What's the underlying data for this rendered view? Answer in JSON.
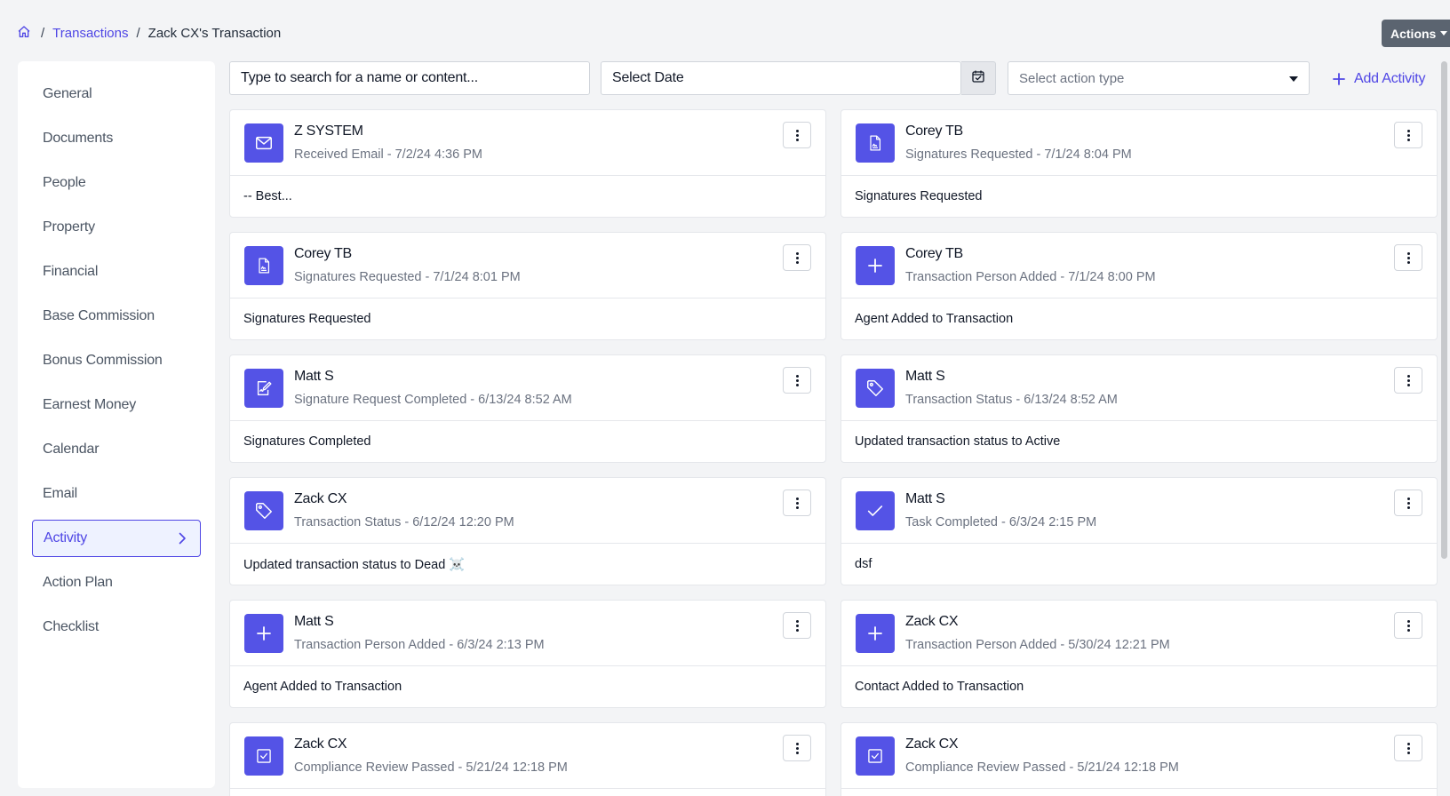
{
  "breadcrumb": {
    "home_icon": "home-icon",
    "separator": "/",
    "transactions": "Transactions",
    "current": "Zack CX's Transaction"
  },
  "actions": {
    "label": "Actions"
  },
  "sidebar": {
    "items": [
      {
        "label": "General"
      },
      {
        "label": "Documents"
      },
      {
        "label": "People"
      },
      {
        "label": "Property"
      },
      {
        "label": "Financial"
      },
      {
        "label": "Base Commission"
      },
      {
        "label": "Bonus Commission"
      },
      {
        "label": "Earnest Money"
      },
      {
        "label": "Calendar"
      },
      {
        "label": "Email"
      },
      {
        "label": "Activity",
        "active": true
      },
      {
        "label": "Action Plan"
      },
      {
        "label": "Checklist"
      }
    ]
  },
  "filters": {
    "search_placeholder": "Type to search for a name or content...",
    "date_placeholder": "Select Date",
    "action_type_placeholder": "Select action type",
    "add_activity": "Add Activity"
  },
  "colors": {
    "accent": "#4f46e5",
    "icon_bg": "#5453e6"
  },
  "activities": [
    {
      "icon": "envelope-icon",
      "name": "Z SYSTEM",
      "meta": "Received Email - 7/2/24 4:36 PM",
      "body": "-- Best..."
    },
    {
      "icon": "signature-document-icon",
      "name": "Corey TB",
      "meta": "Signatures Requested - 7/1/24 8:04 PM",
      "body": "Signatures Requested"
    },
    {
      "icon": "signature-document-icon",
      "name": "Corey TB",
      "meta": "Signatures Requested - 7/1/24 8:01 PM",
      "body": "Signatures Requested"
    },
    {
      "icon": "plus-icon",
      "name": "Corey TB",
      "meta": "Transaction Person Added - 7/1/24 8:00 PM",
      "body": "Agent Added to Transaction"
    },
    {
      "icon": "signed-document-icon",
      "name": "Matt S",
      "meta": "Signature Request Completed - 6/13/24 8:52 AM",
      "body": "Signatures Completed"
    },
    {
      "icon": "tag-icon",
      "name": "Matt S",
      "meta": "Transaction Status - 6/13/24 8:52 AM",
      "body": "Updated transaction status to Active"
    },
    {
      "icon": "tag-icon",
      "name": "Zack CX",
      "meta": "Transaction Status - 6/12/24 12:20 PM",
      "body": "Updated transaction status to Dead ☠️"
    },
    {
      "icon": "checkmark-icon",
      "name": "Matt S",
      "meta": "Task Completed - 6/3/24 2:15 PM",
      "body": "dsf"
    },
    {
      "icon": "plus-icon",
      "name": "Matt S",
      "meta": "Transaction Person Added - 6/3/24 2:13 PM",
      "body": "Agent Added to Transaction"
    },
    {
      "icon": "plus-icon",
      "name": "Zack CX",
      "meta": "Transaction Person Added - 5/30/24 12:21 PM",
      "body": "Contact Added to Transaction"
    },
    {
      "icon": "checkbox-icon",
      "name": "Zack CX",
      "meta": "Compliance Review Passed - 5/21/24 12:18 PM",
      "body": ""
    },
    {
      "icon": "checkbox-icon",
      "name": "Zack CX",
      "meta": "Compliance Review Passed - 5/21/24 12:18 PM",
      "body": ""
    }
  ]
}
